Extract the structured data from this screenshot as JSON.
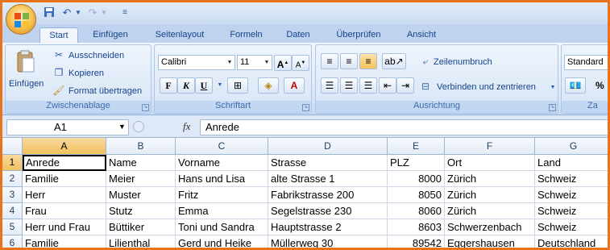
{
  "ribbon_tabs": [
    "Start",
    "Einfügen",
    "Seitenlayout",
    "Formeln",
    "Daten",
    "Überprüfen",
    "Ansicht"
  ],
  "active_tab": "Start",
  "quick_access": {
    "save_icon": "save-icon",
    "undo_icon": "undo-icon",
    "redo_icon": "redo-icon"
  },
  "clipboard": {
    "paste_label": "Einfügen",
    "cut_label": "Ausschneiden",
    "copy_label": "Kopieren",
    "format_painter_label": "Format übertragen",
    "group_label": "Zwischenablage"
  },
  "font": {
    "name": "Calibri",
    "size": "11",
    "bold": "F",
    "italic": "K",
    "underline": "U",
    "group_label": "Schriftart"
  },
  "alignment": {
    "wrap_label": "Zeilenumbruch",
    "merge_label": "Verbinden und zentrieren",
    "group_label": "Ausrichtung"
  },
  "number": {
    "format": "Standard",
    "percent": "%",
    "group_label_partial": "Za"
  },
  "formula_bar": {
    "cell_ref": "A1",
    "fx_label": "fx",
    "content": "Anrede"
  },
  "grid": {
    "columns": [
      "A",
      "B",
      "C",
      "D",
      "E",
      "F",
      "G"
    ],
    "selected_column": "A",
    "rows": [
      {
        "num": "1",
        "cells": [
          "Anrede",
          "Name",
          "Vorname",
          "Strasse",
          "PLZ",
          "Ort",
          "Land"
        ]
      },
      {
        "num": "2",
        "cells": [
          "Familie",
          "Meier",
          "Hans und Lisa",
          "alte Strasse 1",
          "8000",
          "Zürich",
          "Schweiz"
        ]
      },
      {
        "num": "3",
        "cells": [
          "Herr",
          "Muster",
          "Fritz",
          "Fabrikstrasse 200",
          "8050",
          "Zürich",
          "Schweiz"
        ]
      },
      {
        "num": "4",
        "cells": [
          "Frau",
          "Stutz",
          "Emma",
          "Segelstrasse 230",
          "8060",
          "Zürich",
          "Schweiz"
        ]
      },
      {
        "num": "5",
        "cells": [
          "Herr und Frau",
          "Büttiker",
          "Toni und Sandra",
          "Hauptstrasse 2",
          "8603",
          "Schwerzenbach",
          "Schweiz"
        ]
      },
      {
        "num": "6",
        "cells": [
          "Familie",
          "Lilienthal",
          "Gerd und Heike",
          "Müllerweg 30",
          "89542",
          "Eggershausen",
          "Deutschland"
        ]
      }
    ]
  },
  "colors": {
    "frame": "#e8731c",
    "accent": "#15428b",
    "selection": "#f1c15f"
  }
}
